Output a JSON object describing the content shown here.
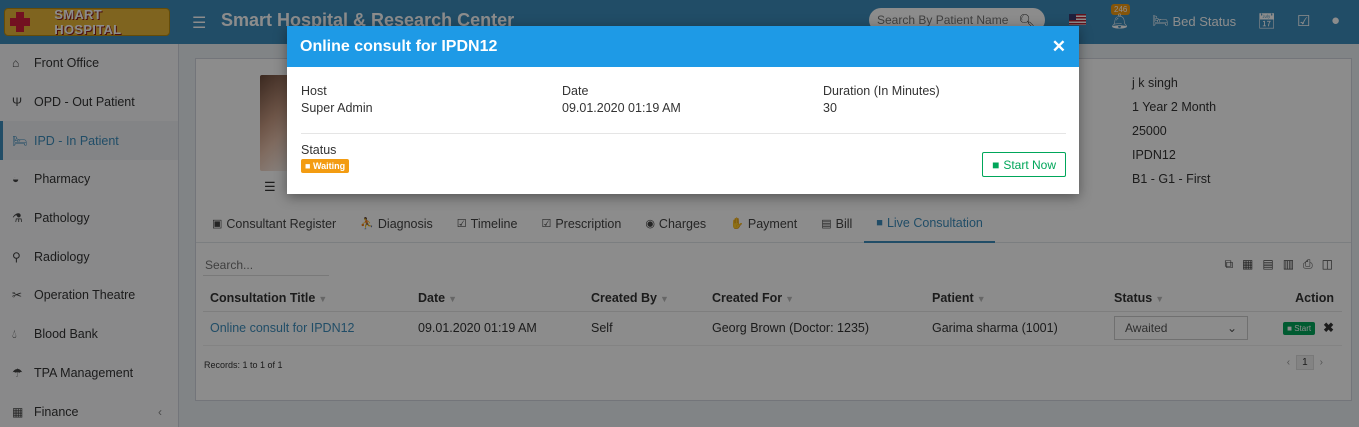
{
  "header": {
    "logo_text": "SMART HOSPITAL",
    "title": "Smart Hospital & Research Center",
    "search_placeholder": "Search By Patient Name",
    "notification_count": "246",
    "bed_status_label": "Bed Status"
  },
  "sidebar": {
    "items": [
      {
        "label": "Front Office",
        "icon": "building-icon"
      },
      {
        "label": "OPD - Out Patient",
        "icon": "stethoscope-icon"
      },
      {
        "label": "IPD - In Patient",
        "icon": "bed-icon"
      },
      {
        "label": "Pharmacy",
        "icon": "mortar-icon"
      },
      {
        "label": "Pathology",
        "icon": "flask-icon"
      },
      {
        "label": "Radiology",
        "icon": "microscope-icon"
      },
      {
        "label": "Operation Theatre",
        "icon": "scissors-icon"
      },
      {
        "label": "Blood Bank",
        "icon": "drop-icon"
      },
      {
        "label": "TPA Management",
        "icon": "umbrella-icon"
      },
      {
        "label": "Finance",
        "icon": "money-icon"
      }
    ]
  },
  "patient_info": {
    "consultant": "j k singh",
    "age": "1 Year 2 Month",
    "credit_limit": "25000",
    "ipd_no": "IPDN12",
    "bed": "B1 - G1 - First"
  },
  "tabs": [
    {
      "label": "Consultant Register",
      "icon": "register-icon"
    },
    {
      "label": "Diagnosis",
      "icon": "diagnosis-icon"
    },
    {
      "label": "Timeline",
      "icon": "calendar-check-icon"
    },
    {
      "label": "Prescription",
      "icon": "calendar-check-icon"
    },
    {
      "label": "Charges",
      "icon": "money-icon"
    },
    {
      "label": "Payment",
      "icon": "hand-money-icon"
    },
    {
      "label": "Bill",
      "icon": "file-icon"
    },
    {
      "label": "Live Consultation",
      "icon": "video-icon"
    }
  ],
  "table": {
    "search_placeholder": "Search...",
    "columns": [
      "Consultation Title",
      "Date",
      "Created By",
      "Created For",
      "Patient",
      "Status",
      "Action"
    ],
    "rows": [
      {
        "title": "Online consult for IPDN12",
        "date": "09.01.2020 01:19 AM",
        "created_by": "Self",
        "created_for": "Georg Brown (Doctor: 1235)",
        "patient": "Garima sharma (1001)",
        "status": "Awaited",
        "action_start": "Start"
      }
    ],
    "records_text": "Records: 1 to 1 of 1",
    "current_page": "1"
  },
  "modal": {
    "title": "Online consult for IPDN12",
    "host_label": "Host",
    "host_value": "Super Admin",
    "date_label": "Date",
    "date_value": "09.01.2020 01:19 AM",
    "duration_label": "Duration (In Minutes)",
    "duration_value": "30",
    "status_label": "Status",
    "status_value": "Waiting",
    "start_button": "Start Now"
  },
  "colors": {
    "header_bg": "#3c8dbc",
    "modal_header_bg": "#1e9ae6",
    "accent": "#3c8dbc",
    "success": "#00a65a",
    "warning": "#f39c12"
  }
}
